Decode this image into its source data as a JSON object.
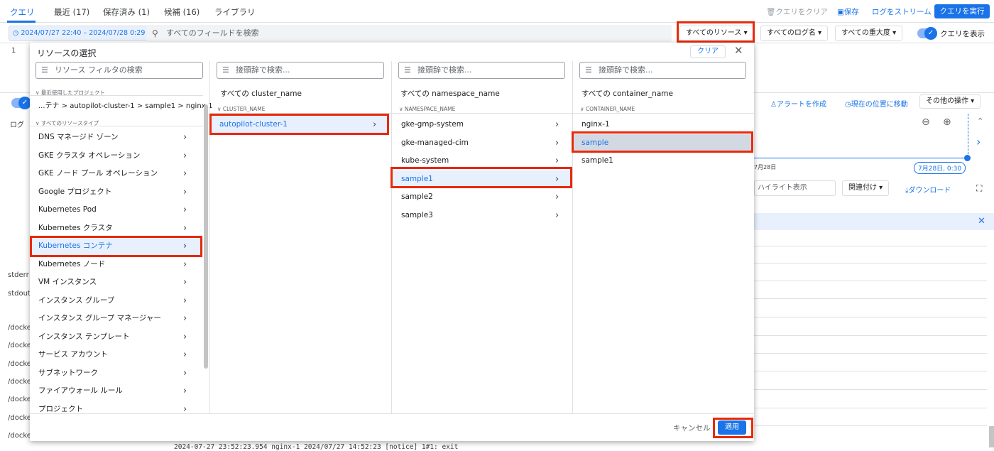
{
  "tabs": [
    {
      "label": "クエリ",
      "active": true
    },
    {
      "label": "最近 (17)",
      "active": false
    },
    {
      "label": "保存済み (1)",
      "active": false
    },
    {
      "label": "候補 (16)",
      "active": false
    },
    {
      "label": "ライブラリ",
      "active": false
    }
  ],
  "toolbar": {
    "clear_query": "クエリをクリア",
    "save": "保存",
    "stream": "ログをストリーム",
    "run": "クエリを実行"
  },
  "filter": {
    "date_range": "2024/07/27 22:40 – 2024/07/28 0:29",
    "search_placeholder": "すべてのフィールドを検索",
    "resources": "すべてのリソース ▾",
    "log_names": "すべてのログ名 ▾",
    "severity": "すべての重大度 ▾",
    "show_query": "クエリを表示"
  },
  "background": {
    "line_number": "1",
    "create_alert": "アラートを作成",
    "jump_now": "現在の位置に移動",
    "more_actions": "その他の操作 ▾",
    "timeline_start": "7月28日",
    "timeline_chip": "7月28日, 0:30",
    "highlight_placeholder": "ハイライト表示",
    "correlate": "関連付け ▾",
    "download": "ダウンロード",
    "left_labels": [
      "ログ",
      "stderr",
      "stdout",
      "/docke",
      "/docke",
      "/docke",
      "/docke",
      "/docke",
      "/docke",
      "/docke"
    ],
    "log_row": "2024-07-27 23:52:23.954   nginx-1   2024/07/27 14:52:23 [notice] 1#1: exit"
  },
  "dialog": {
    "title": "リソースの選択",
    "clear": "クリア",
    "cancel": "キャンセル",
    "apply": "適用",
    "resource_col": {
      "filter_placeholder": "リソース フィルタの検索",
      "recent_header": "最近使用したプロジェクト",
      "recent_item": "...テナ > autopilot-cluster-1 > sample1 > nginx-1",
      "types_header": "すべてのリソースタイプ",
      "items": [
        "DNS マネージド ゾーン",
        "GKE クラスタ オペレーション",
        "GKE ノード プール オペレーション",
        "Google プロジェクト",
        "Kubernetes Pod",
        "Kubernetes クラスタ",
        "Kubernetes コンテナ",
        "Kubernetes ノード",
        "VM インスタンス",
        "インスタンス グループ",
        "インスタンス グループ マネージャー",
        "インスタンス テンプレート",
        "サービス アカウント",
        "サブネットワーク",
        "ファイアウォール ルール",
        "プロジェクト"
      ],
      "selected_index": 6
    },
    "cluster_col": {
      "placeholder": "接頭辞で検索...",
      "all_label": "すべての cluster_name",
      "header": "CLUSTER_NAME",
      "items": [
        "autopilot-cluster-1"
      ],
      "selected_index": 0
    },
    "namespace_col": {
      "placeholder": "接頭辞で検索...",
      "all_label": "すべての namespace_name",
      "header": "NAMESPACE_NAME",
      "items": [
        "gke-gmp-system",
        "gke-managed-cim",
        "kube-system",
        "sample1",
        "sample2",
        "sample3"
      ],
      "selected_index": 3
    },
    "container_col": {
      "placeholder": "接頭辞で検索...",
      "all_label": "すべての container_name",
      "header": "CONTAINER_NAME",
      "items": [
        "nginx-1",
        "sample",
        "sample1"
      ],
      "selected_index": 1
    }
  },
  "colors": {
    "accent": "#1a73e8",
    "highlight": "#e8290b",
    "selected_bg": "#e8f0fe"
  }
}
